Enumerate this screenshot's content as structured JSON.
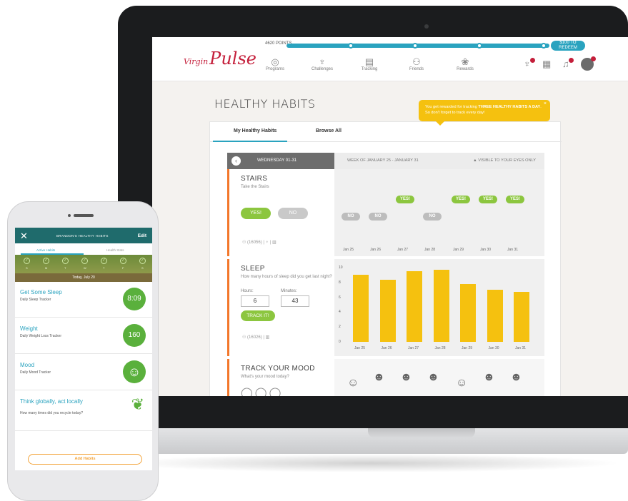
{
  "nav": {
    "logo_small": "Virgin",
    "logo": "Pulse",
    "points_label": "4620 POINTS",
    "reward_pill": "$100 TO REDEEM",
    "items": [
      {
        "label": "Programs",
        "icon": "globe-icon"
      },
      {
        "label": "Challenges",
        "icon": "trophy-icon"
      },
      {
        "label": "Tracking",
        "icon": "tracking-icon"
      },
      {
        "label": "Friends",
        "icon": "friends-icon"
      },
      {
        "label": "Rewards",
        "icon": "rewards-icon"
      }
    ]
  },
  "page": {
    "title": "HEALTHY HABITS",
    "tooltip_pre": "You get rewarded for tracking ",
    "tooltip_bold": "THREE HEALTHY HABITS A DAY",
    "tooltip_post": ". So don't forget to track every day!",
    "tooltip_close": "×",
    "tabs": [
      "My Healthy Habits",
      "Browse All"
    ],
    "day_label": "WEDNESDAY 01-31",
    "week_label": "WEEK OF JANUARY 25 - JANUARY 31",
    "visibility": "VISIBLE TO YOUR EYES ONLY",
    "dates": [
      "Jan 25",
      "Jan 26",
      "Jan 27",
      "Jan 28",
      "Jan 29",
      "Jan 30",
      "Jan 31"
    ]
  },
  "stairs": {
    "title": "STAIRS",
    "desc": "Take the Stairs",
    "yes": "YES!",
    "no": "NO",
    "meta": "(16056)",
    "week": [
      "NO",
      "NO",
      "YES!",
      "NO",
      "YES!",
      "YES!",
      "YES!"
    ]
  },
  "sleep": {
    "title": "SLEEP",
    "desc": "How many hours of sleep did you get last night?",
    "hours_label": "Hours:",
    "minutes_label": "Minutes:",
    "hours": "6",
    "minutes": "43",
    "track": "TRACK IT!",
    "meta": "(16026)"
  },
  "mood": {
    "title": "TRACK YOUR MOOD",
    "desc": "What's your mood today?"
  },
  "chart_data": {
    "type": "bar",
    "categories": [
      "Jan 25",
      "Jan 26",
      "Jan 27",
      "Jan 28",
      "Jan 29",
      "Jan 30",
      "Jan 31"
    ],
    "values": [
      9,
      8.4,
      9.5,
      9.7,
      7.8,
      7,
      6.7
    ],
    "ylim": [
      0,
      10
    ],
    "yticks": [
      "0",
      "2",
      "4",
      "6",
      "8",
      "10"
    ],
    "bar_color": "#f5c10f"
  },
  "phone": {
    "header": "BRANDON'S HEALTHY HABITS",
    "edit": "Edit",
    "tabs": [
      "Active Habits",
      "Health Stats"
    ],
    "days": [
      "S",
      "M",
      "T",
      "W",
      "T",
      "F",
      "S"
    ],
    "today": "Today, July 20",
    "habits": [
      {
        "title": "Get Some Sleep",
        "sub": "Daily Sleep Tracker",
        "value": "8:09"
      },
      {
        "title": "Weight",
        "sub": "Daily Weight Loss Tracker",
        "value": "160"
      },
      {
        "title": "Mood",
        "sub": "Daily Mood Tracker",
        "value": "☺"
      },
      {
        "title": "Think globally, act locally",
        "sub": "How many times did you recycle today?",
        "value": ""
      }
    ],
    "add": "Add Habits"
  }
}
